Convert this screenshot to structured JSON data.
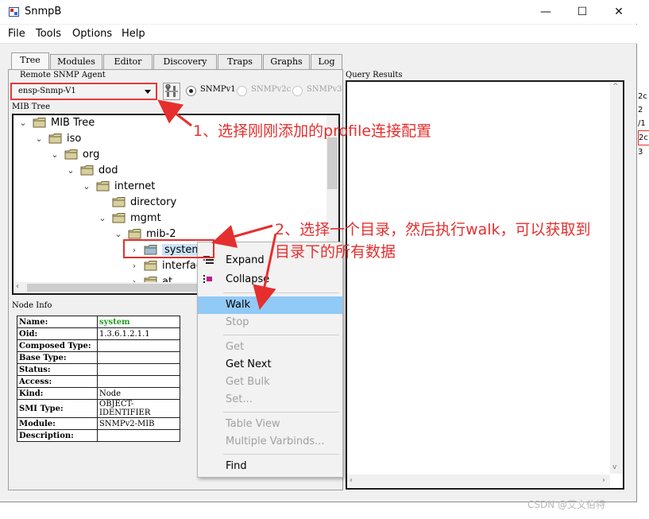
{
  "window": {
    "title": "SnmpB",
    "minimize": "—",
    "maximize": "☐",
    "close": "✕"
  },
  "menubar": [
    "File",
    "Tools",
    "Options",
    "Help"
  ],
  "tabs": [
    "Tree",
    "Modules",
    "Editor",
    "Discovery",
    "Traps",
    "Graphs",
    "Log"
  ],
  "remote_agent": {
    "group_label": "Remote SNMP Agent",
    "selected_agent": "ensp-Snmp-V1",
    "versions": [
      {
        "label": "SNMPv1",
        "checked": true,
        "enabled": true
      },
      {
        "label": "SNMPv2c",
        "checked": false,
        "enabled": false
      },
      {
        "label": "SNMPv3",
        "checked": false,
        "enabled": false
      }
    ]
  },
  "query_results": {
    "label": "Query Results"
  },
  "mib_tree": {
    "label": "MIB Tree",
    "nodes": [
      {
        "label": "MIB Tree",
        "level": 0,
        "state": "expanded",
        "selected": false
      },
      {
        "label": "iso",
        "level": 1,
        "state": "expanded",
        "selected": false
      },
      {
        "label": "org",
        "level": 2,
        "state": "expanded",
        "selected": false
      },
      {
        "label": "dod",
        "level": 3,
        "state": "expanded",
        "selected": false
      },
      {
        "label": "internet",
        "level": 4,
        "state": "expanded",
        "selected": false
      },
      {
        "label": "directory",
        "level": 5,
        "state": "leaf",
        "selected": false
      },
      {
        "label": "mgmt",
        "level": 5,
        "state": "expanded",
        "selected": false
      },
      {
        "label": "mib-2",
        "level": 6,
        "state": "expanded",
        "selected": false
      },
      {
        "label": "system",
        "level": 7,
        "state": "collapsed",
        "selected": true
      },
      {
        "label": "interfaces",
        "level": 7,
        "state": "collapsed",
        "selected": false
      },
      {
        "label": "at",
        "level": 7,
        "state": "collapsed",
        "selected": false
      }
    ]
  },
  "node_info": {
    "label": "Node Info",
    "rows": [
      {
        "key": "Name:",
        "value": "system",
        "highlight": true
      },
      {
        "key": "Oid:",
        "value": "1.3.6.1.2.1.1"
      },
      {
        "key": "Composed Type:",
        "value": ""
      },
      {
        "key": "Base Type:",
        "value": ""
      },
      {
        "key": "Status:",
        "value": ""
      },
      {
        "key": "Access:",
        "value": ""
      },
      {
        "key": "Kind:",
        "value": "Node"
      },
      {
        "key": "SMI Type:",
        "value": "OBJECT-IDENTIFIER"
      },
      {
        "key": "Module:",
        "value": "SNMPv2-MIB"
      },
      {
        "key": "Description:",
        "value": ""
      }
    ]
  },
  "context_menu": {
    "expand": "Expand",
    "collapse": "Collapse",
    "walk": "Walk",
    "stop": "Stop",
    "get": "Get",
    "get_next": "Get Next",
    "get_bulk": "Get Bulk",
    "set": "Set...",
    "table_view": "Table View",
    "multiple_varbinds": "Multiple Varbinds...",
    "find": "Find"
  },
  "annotations": {
    "step1": "1、选择刚刚添加的profile连接配置",
    "step2_line1": "2、选择一个目录，然后执行walk，可以获取到",
    "step2_line2": "目录下的所有数据"
  },
  "side_strip": [
    "2c",
    "2",
    "/1",
    "2c",
    "3"
  ],
  "watermark": "CSDN @艾文伯特",
  "colors": {
    "annotation": "#e52f2f",
    "highlight": "#91c9f7",
    "name_value": "#1e9e1e"
  }
}
